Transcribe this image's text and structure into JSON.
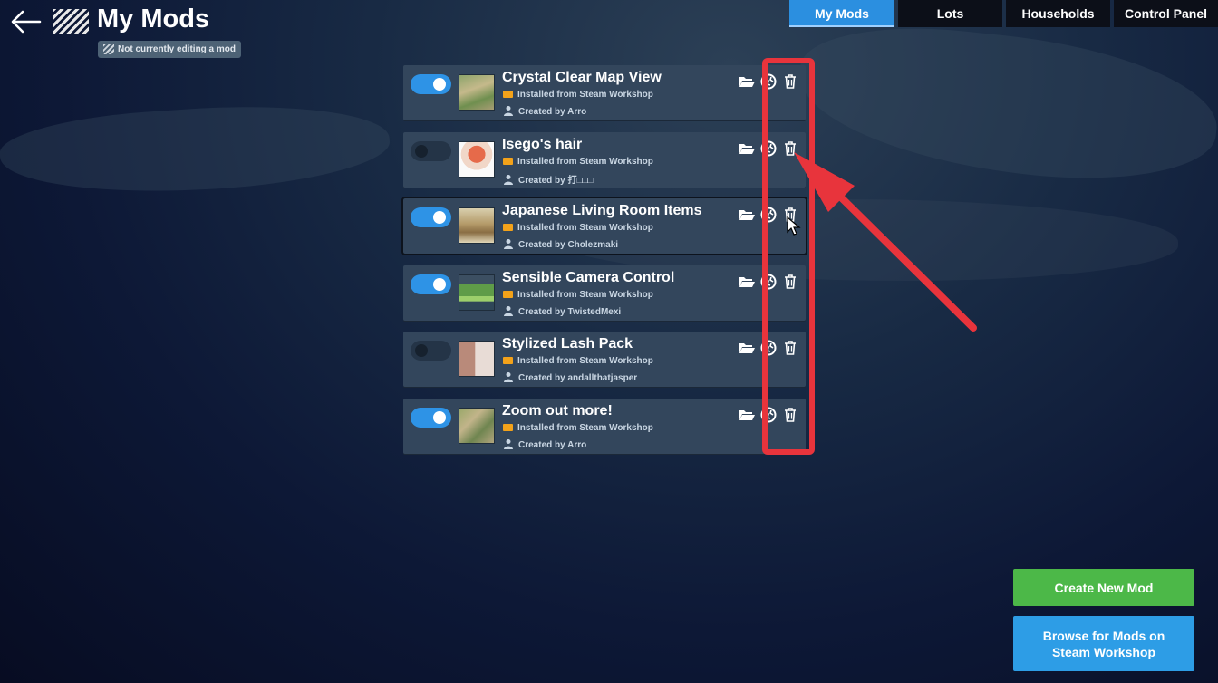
{
  "header": {
    "title": "My Mods",
    "edit_status": "Not currently editing a mod"
  },
  "tabs": [
    {
      "label": "My Mods",
      "active": true
    },
    {
      "label": "Lots",
      "active": false
    },
    {
      "label": "Households",
      "active": false
    },
    {
      "label": "Control Panel",
      "active": false
    }
  ],
  "mods": [
    {
      "name": "Crystal Clear Map View",
      "source": "Installed from Steam Workshop",
      "creator": "Created by Arro",
      "enabled": true
    },
    {
      "name": "Isego's hair",
      "source": "Installed from Steam Workshop",
      "creator": "Created by 打□□□",
      "enabled": false
    },
    {
      "name": "Japanese Living Room Items",
      "source": "Installed from Steam Workshop",
      "creator": "Created by Cholezmaki",
      "enabled": true
    },
    {
      "name": "Sensible Camera Control",
      "source": "Installed from Steam Workshop",
      "creator": "Created by TwistedMexi",
      "enabled": true
    },
    {
      "name": "Stylized Lash Pack",
      "source": "Installed from Steam Workshop",
      "creator": "Created by andallthatjasper",
      "enabled": false
    },
    {
      "name": "Zoom out more!",
      "source": "Installed from Steam Workshop",
      "creator": "Created by Arro",
      "enabled": true
    }
  ],
  "buttons": {
    "create": "Create New Mod",
    "browse": "Browse for Mods on\nSteam Workshop"
  },
  "icons": {
    "back": "arrow-left-icon",
    "folder": "folder-open-icon",
    "globe": "globe-icon",
    "trash": "trash-icon"
  },
  "colors": {
    "accent_blue": "#2b8fe0",
    "create_green": "#4cb848",
    "browse_blue": "#2d9de6",
    "annotation_red": "#e8343c",
    "card_bg": "#33465c"
  }
}
